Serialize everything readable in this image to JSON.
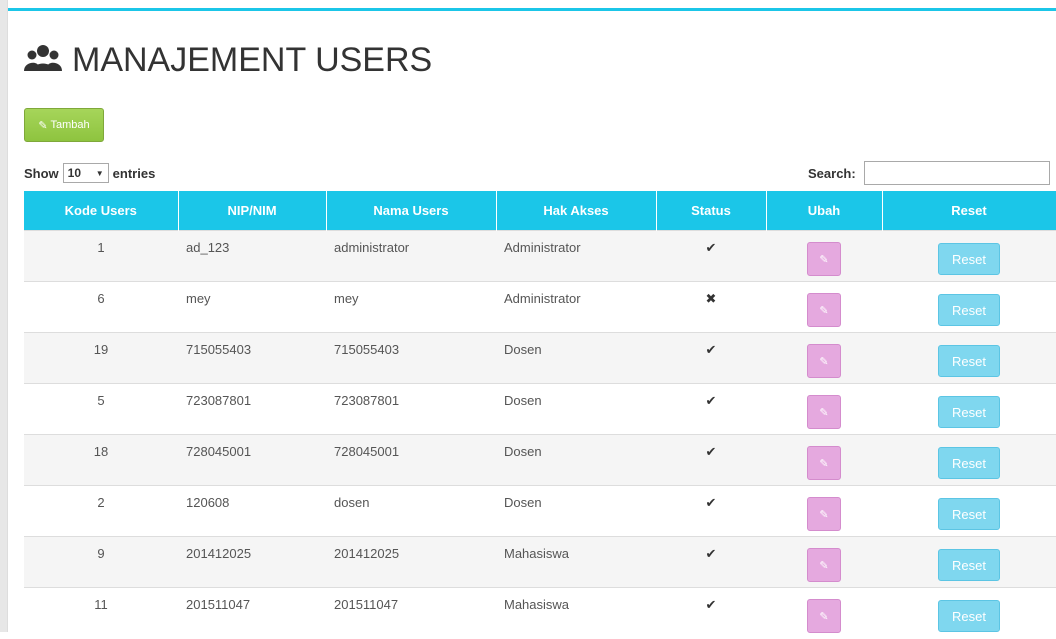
{
  "page": {
    "title": "MANAJEMENT USERS",
    "icon": "users-icon"
  },
  "toolbar": {
    "add_label": "Tambah",
    "add_icon": "pencil-icon"
  },
  "length_control": {
    "show_label": "Show",
    "value": "10",
    "entries_label": "entries"
  },
  "search": {
    "label": "Search:",
    "value": ""
  },
  "table": {
    "columns": [
      "Kode Users",
      "NIP/NIM",
      "Nama Users",
      "Hak Akses",
      "Status",
      "Ubah",
      "Reset"
    ],
    "reset_label": "Reset",
    "rows": [
      {
        "kode": "1",
        "nip": "ad_123",
        "nama": "administrator",
        "hak": "Administrator",
        "status": "✔"
      },
      {
        "kode": "6",
        "nip": "mey",
        "nama": "mey",
        "hak": "Administrator",
        "status": "✖"
      },
      {
        "kode": "19",
        "nip": "715055403",
        "nama": "715055403",
        "hak": "Dosen",
        "status": "✔"
      },
      {
        "kode": "5",
        "nip": "723087801",
        "nama": "723087801",
        "hak": "Dosen",
        "status": "✔"
      },
      {
        "kode": "18",
        "nip": "728045001",
        "nama": "728045001",
        "hak": "Dosen",
        "status": "✔"
      },
      {
        "kode": "2",
        "nip": "120608",
        "nama": "dosen",
        "hak": "Dosen",
        "status": "✔"
      },
      {
        "kode": "9",
        "nip": "201412025",
        "nama": "201412025",
        "hak": "Mahasiswa",
        "status": "✔"
      },
      {
        "kode": "11",
        "nip": "201511047",
        "nama": "201511047",
        "hak": "Mahasiswa",
        "status": "✔"
      }
    ]
  },
  "colors": {
    "accent": "#1bc6e8",
    "add_button": "#8ec43f",
    "edit_button": "#e5a9df",
    "reset_button": "#7fd7ef"
  }
}
